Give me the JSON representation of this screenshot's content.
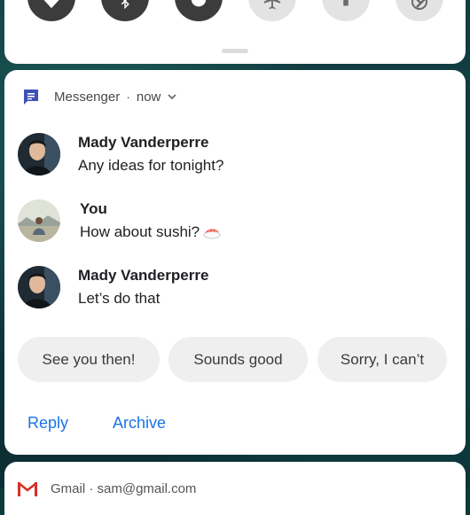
{
  "quick_settings": {
    "tiles": [
      {
        "name": "wifi",
        "icon": "wifi-icon",
        "state": "on"
      },
      {
        "name": "bluetooth",
        "icon": "bluetooth-icon",
        "state": "on"
      },
      {
        "name": "do-not-disturb",
        "icon": "do-not-disturb-icon",
        "state": "on"
      },
      {
        "name": "airplane-mode",
        "icon": "airplane-icon",
        "state": "off"
      },
      {
        "name": "flashlight",
        "icon": "flashlight-icon",
        "state": "off"
      },
      {
        "name": "auto-rotate",
        "icon": "rotate-icon",
        "state": "off"
      }
    ]
  },
  "notification": {
    "app_name": "Messenger",
    "separator": "·",
    "time": "now",
    "messages": [
      {
        "sender": "Mady Vanderperre",
        "text": "Any ideas for tonight?"
      },
      {
        "sender": "You",
        "text": "How about sushi?",
        "emoji": "sushi-icon"
      },
      {
        "sender": "Mady Vanderperre",
        "text": "Let’s do that"
      }
    ],
    "smart_replies": [
      "See you then!",
      "Sounds good",
      "Sorry, I can’t"
    ],
    "actions": {
      "reply": "Reply",
      "archive": "Archive"
    }
  },
  "next_notification": {
    "app_icon": "gmail-icon",
    "title": "Gmail · sam@gmail.com"
  },
  "colors": {
    "accent": "#1a73e8",
    "messenger_icon": "#3f51b5",
    "gmail_red": "#d93025"
  }
}
